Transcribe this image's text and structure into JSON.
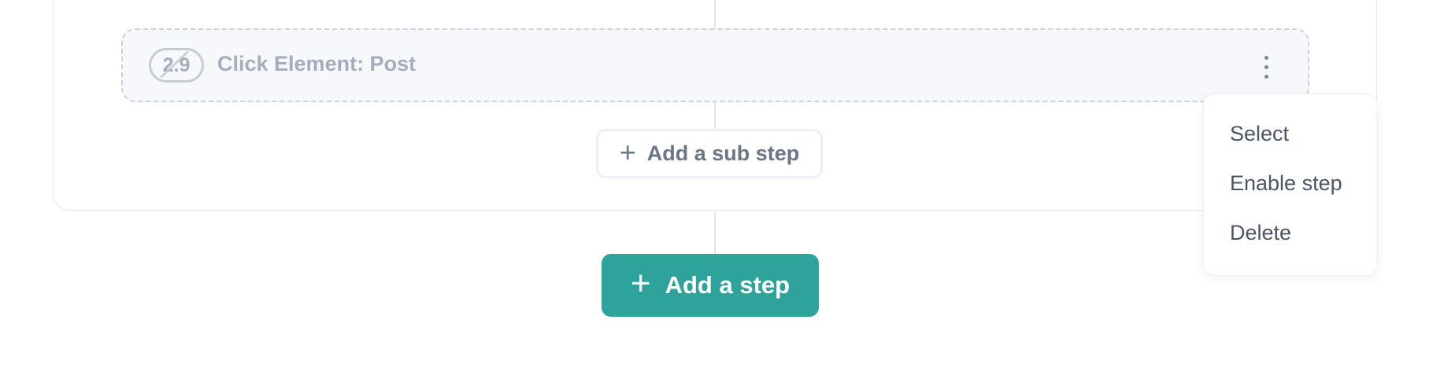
{
  "step": {
    "substep": {
      "number": "2.9",
      "title": "Click Element: Post",
      "disabled": true,
      "menu_icon": "kebab-icon"
    },
    "add_sub_step_label": "Add a sub step",
    "plus_icon": "plus-icon"
  },
  "add_step_label": "Add a step",
  "context_menu": {
    "items": [
      {
        "label": "Select"
      },
      {
        "label": "Enable step"
      },
      {
        "label": "Delete"
      }
    ]
  },
  "colors": {
    "accent": "#2ea39c",
    "disabled_text": "#a4adb9",
    "menu_text": "#4b5563"
  }
}
